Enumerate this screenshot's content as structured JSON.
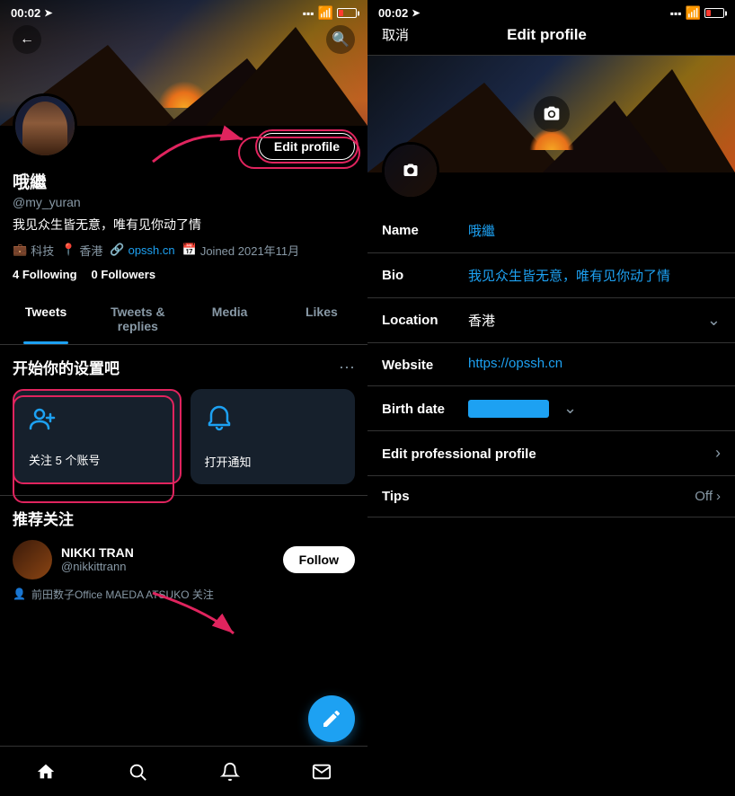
{
  "left": {
    "statusBar": {
      "time": "00:02",
      "signal": "📶"
    },
    "profile": {
      "displayName": "哦繼",
      "username": "@my_yuran",
      "bio": "我见众生皆无意，唯有见你动了情",
      "category": "科技",
      "location": "香港",
      "website": "opssh.cn",
      "joined": "Joined 2021年11月",
      "following": "4",
      "followers": "0",
      "followingLabel": "Following",
      "followersLabel": "Followers"
    },
    "editProfileBtn": "Edit profile",
    "tabs": [
      {
        "label": "Tweets",
        "active": true
      },
      {
        "label": "Tweets & replies",
        "active": false
      },
      {
        "label": "Media",
        "active": false
      },
      {
        "label": "Likes",
        "active": false
      }
    ],
    "setup": {
      "title": "开始你的设置吧",
      "cards": [
        {
          "icon": "👤+",
          "label": "关注 5 个账号"
        },
        {
          "icon": "🔔",
          "label": "打开通知"
        }
      ]
    },
    "suggested": {
      "title": "推荐关注",
      "user": {
        "name": "NIKKI TRAN",
        "handle": "@nikkittrann",
        "followLabel": "Follow",
        "mutualText": "前田数子Office MAEDA ATSUKO 关注"
      }
    },
    "nav": {
      "home": "🏠",
      "search": "🔍",
      "notifications": "🔔",
      "messages": "✉️"
    }
  },
  "right": {
    "statusBar": {
      "time": "00:02"
    },
    "header": {
      "cancel": "取消",
      "title": "Edit profile"
    },
    "fields": [
      {
        "label": "Name",
        "value": "哦繼",
        "type": "text"
      },
      {
        "label": "Bio",
        "value": "我见众生皆无意，唯有见你动了情",
        "type": "text"
      },
      {
        "label": "Location",
        "value": "香港",
        "type": "dropdown"
      },
      {
        "label": "Website",
        "value": "https://opssh.cn",
        "type": "text"
      },
      {
        "label": "Birth date",
        "value": "",
        "type": "birthdate"
      },
      {
        "label": "Edit professional profile",
        "value": "",
        "type": "arrow"
      },
      {
        "label": "Tips",
        "value": "Off",
        "type": "toggle"
      }
    ]
  }
}
